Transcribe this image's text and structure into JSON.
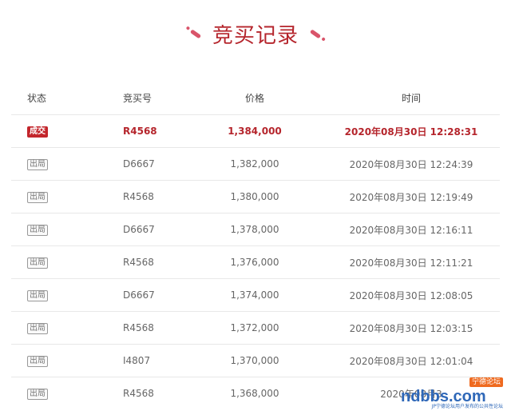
{
  "title": "竞买记录",
  "headers": {
    "status": "状态",
    "code": "竞买号",
    "price": "价格",
    "time": "时间"
  },
  "rows": [
    {
      "status": "成交",
      "code": "R4568",
      "price": "1,384,000",
      "time": "2020年08月30日 12:28:31"
    },
    {
      "status": "出局",
      "code": "D6667",
      "price": "1,382,000",
      "time": "2020年08月30日 12:24:39"
    },
    {
      "status": "出局",
      "code": "R4568",
      "price": "1,380,000",
      "time": "2020年08月30日 12:19:49"
    },
    {
      "status": "出局",
      "code": "D6667",
      "price": "1,378,000",
      "time": "2020年08月30日 12:16:11"
    },
    {
      "status": "出局",
      "code": "R4568",
      "price": "1,376,000",
      "time": "2020年08月30日 12:11:21"
    },
    {
      "status": "出局",
      "code": "D6667",
      "price": "1,374,000",
      "time": "2020年08月30日 12:08:05"
    },
    {
      "status": "出局",
      "code": "R4568",
      "price": "1,372,000",
      "time": "2020年08月30日 12:03:15"
    },
    {
      "status": "出局",
      "code": "I4807",
      "price": "1,370,000",
      "time": "2020年08月30日 12:01:04"
    },
    {
      "status": "出局",
      "code": "R4568",
      "price": "1,368,000",
      "time": "2020年08月3"
    }
  ],
  "watermark": {
    "main": "ndbbs.com",
    "tag": "宁德论坛",
    "sub": "JP宁德论坛用户发布的公共性论坛"
  },
  "colors": {
    "accent": "#b5252c",
    "deco": "#d9546a",
    "divider": "#e8e8e8"
  }
}
